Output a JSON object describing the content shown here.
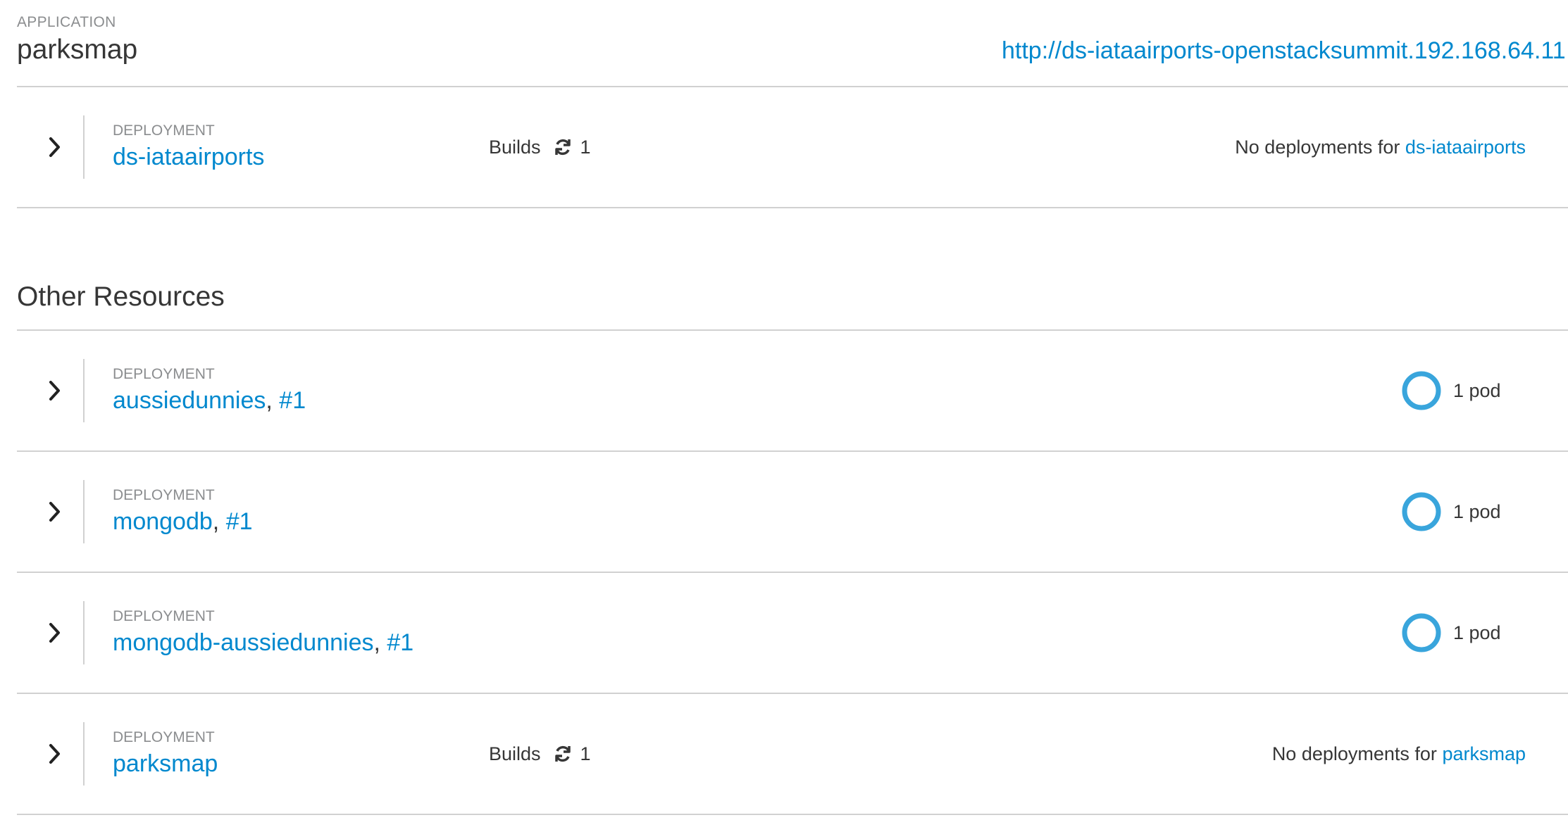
{
  "application": {
    "kicker": "APPLICATION",
    "name": "parksmap",
    "route_url": "http://ds-iataairports-openstacksummit.192.168.64.11"
  },
  "app_deployment": {
    "kicker": "DEPLOYMENT",
    "name": "ds-iataairports",
    "builds_label": "Builds",
    "builds_count": "1",
    "no_deploy_text": "No deployments for",
    "no_deploy_link": "ds-iataairports"
  },
  "other_resources": {
    "title": "Other Resources",
    "items": [
      {
        "kicker": "DEPLOYMENT",
        "name": "aussiedunnies",
        "sep": ",",
        "rev": "#1",
        "pods": "1 pod"
      },
      {
        "kicker": "DEPLOYMENT",
        "name": "mongodb",
        "sep": ",",
        "rev": "#1",
        "pods": "1 pod"
      },
      {
        "kicker": "DEPLOYMENT",
        "name": "mongodb-aussiedunnies",
        "sep": ",",
        "rev": "#1",
        "pods": "1 pod"
      },
      {
        "kicker": "DEPLOYMENT",
        "name": "parksmap",
        "builds_label": "Builds",
        "builds_count": "1",
        "no_deploy_text": "No deployments for",
        "no_deploy_link": "parksmap"
      }
    ]
  },
  "icons": {
    "chevron": "chevron-right-icon",
    "sync": "sync-icon",
    "pod_donut": "pod-donut-icon"
  },
  "colors": {
    "link": "#0088ce",
    "pod_ring": "#39a5dc",
    "divider": "#d1d1d1",
    "muted": "#8b8d8f"
  }
}
